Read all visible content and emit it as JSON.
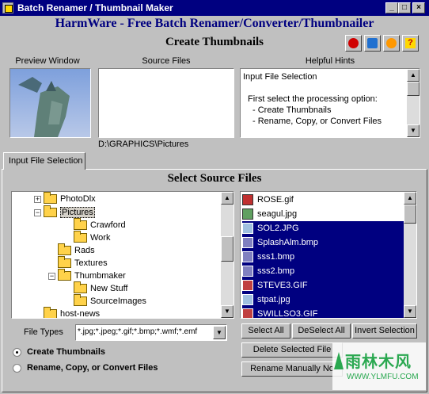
{
  "window": {
    "title": "Batch Renamer / Thumbnail Maker"
  },
  "header": {
    "subtitle": "HarmWare - Free Batch Renamer/Converter/Thumbnailer",
    "mode_title": "Create Thumbnails"
  },
  "panels": {
    "preview_label": "Preview Window",
    "source_label": "Source Files",
    "hints_label": "Helpful Hints",
    "source_path": "D:\\GRAPHICS\\Pictures"
  },
  "hints": {
    "title": "Input File Selection",
    "line1": "First select the processing option:",
    "line2": "- Create Thumbnails",
    "line3": "- Rename, Copy, or Convert Files"
  },
  "tab": {
    "label": "Input File Selection"
  },
  "section_title": "Select Source Files",
  "tree": [
    {
      "label": "PhotoDlx"
    },
    {
      "label": "Pictures"
    },
    {
      "label": "Crawford"
    },
    {
      "label": "Work"
    },
    {
      "label": "Rads"
    },
    {
      "label": "Textures"
    },
    {
      "label": "Thumbmaker"
    },
    {
      "label": "New Stuff"
    },
    {
      "label": "SourceImages"
    },
    {
      "label": "host-news"
    }
  ],
  "files": [
    {
      "name": "ROSE.gif"
    },
    {
      "name": "seagul.jpg"
    },
    {
      "name": "SOL2.JPG"
    },
    {
      "name": "SplashAlm.bmp"
    },
    {
      "name": "sss1.bmp"
    },
    {
      "name": "sss2.bmp"
    },
    {
      "name": "STEVE3.GIF"
    },
    {
      "name": "stpat.jpg"
    },
    {
      "name": "SWILLSO3.GIF"
    }
  ],
  "file_types": {
    "label": "File Types",
    "value": "*.jpg;*.jpeg;*.gif;*.bmp;*.wmf;*.emf"
  },
  "buttons": {
    "select_all": "Select All",
    "deselect_all": "DeSelect All",
    "invert_selection": "Invert Selection",
    "delete_selected": "Delete Selected File",
    "rename_manually": "Rename Manually No"
  },
  "options": {
    "create_thumbnails": "Create Thumbnails",
    "rename_copy_convert": "Rename, Copy, or Convert Files"
  },
  "watermark": {
    "text": "雨林木风",
    "url": "WWW.YLMFU.COM"
  }
}
